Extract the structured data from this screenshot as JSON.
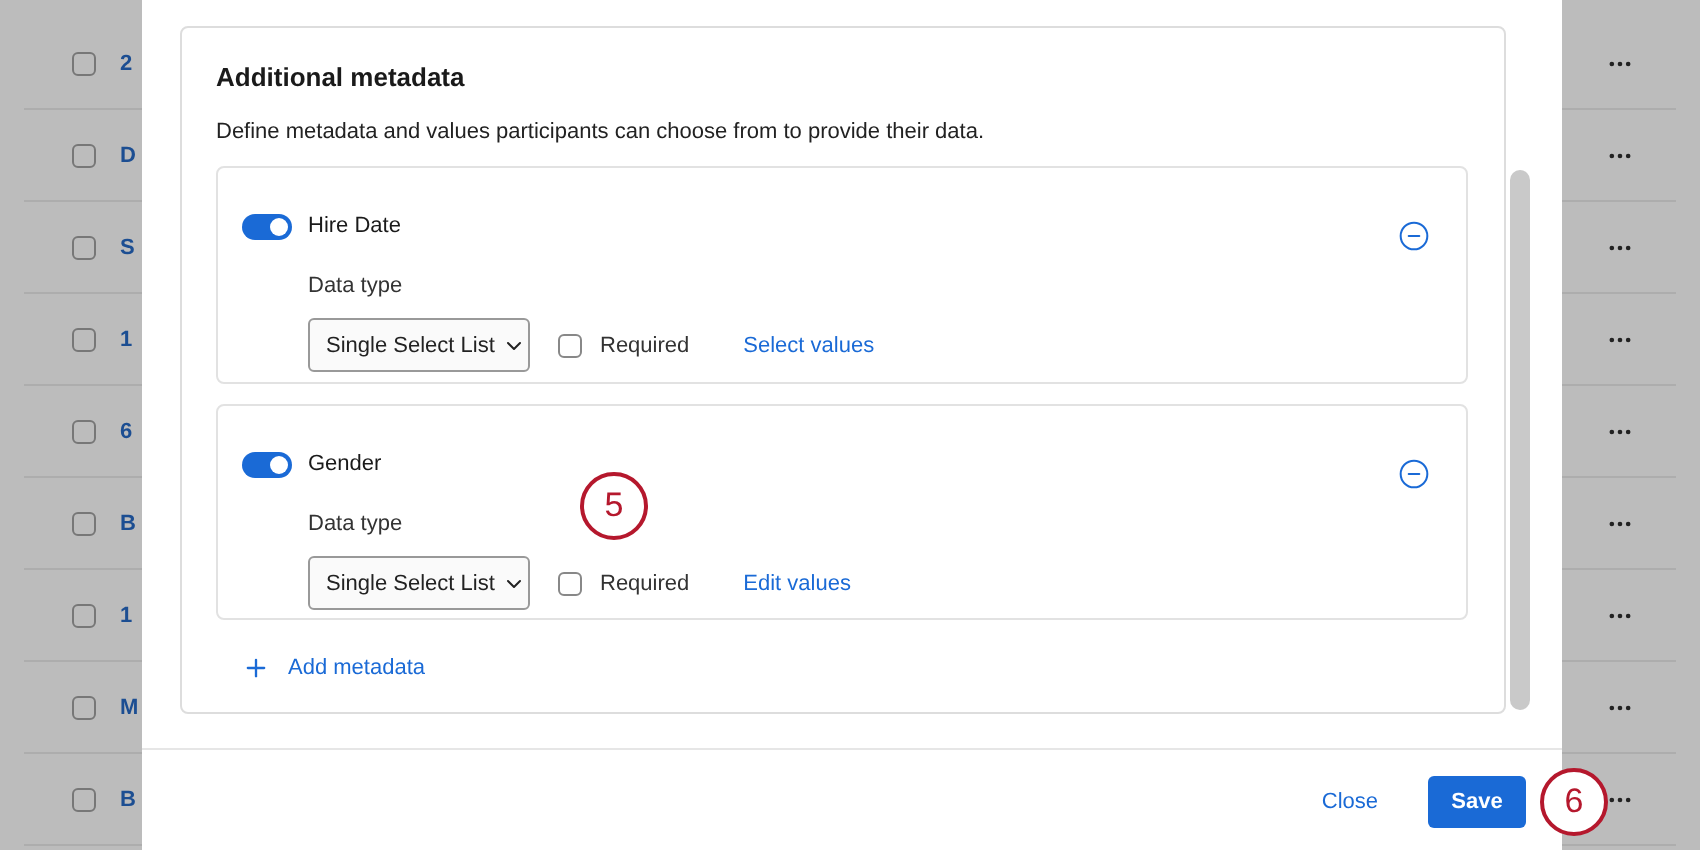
{
  "background_table": {
    "rows": [
      {
        "checked": false,
        "cell": "2"
      },
      {
        "checked": false,
        "cell": "D"
      },
      {
        "checked": false,
        "cell": "S"
      },
      {
        "checked": false,
        "cell": "1"
      },
      {
        "checked": false,
        "cell": "6"
      },
      {
        "checked": false,
        "cell": "B"
      },
      {
        "checked": false,
        "cell": "1"
      },
      {
        "checked": false,
        "cell": "M"
      },
      {
        "checked": false,
        "cell": "B"
      }
    ]
  },
  "modal": {
    "section": {
      "title": "Additional metadata",
      "description": "Define metadata and values participants can choose from to provide their data.",
      "items": [
        {
          "name": "Hire Date",
          "enabled": true,
          "data_type_label": "Data type",
          "data_type": "Single Select List",
          "required_label": "Required",
          "required": false,
          "action_link": "Select values"
        },
        {
          "name": "Gender",
          "enabled": true,
          "data_type_label": "Data type",
          "data_type": "Single Select List",
          "required_label": "Required",
          "required": false,
          "action_link": "Edit values"
        }
      ],
      "add_button": "Add metadata"
    },
    "footer": {
      "close": "Close",
      "save": "Save"
    }
  },
  "annotations": [
    {
      "label": "5"
    },
    {
      "label": "6"
    }
  ]
}
